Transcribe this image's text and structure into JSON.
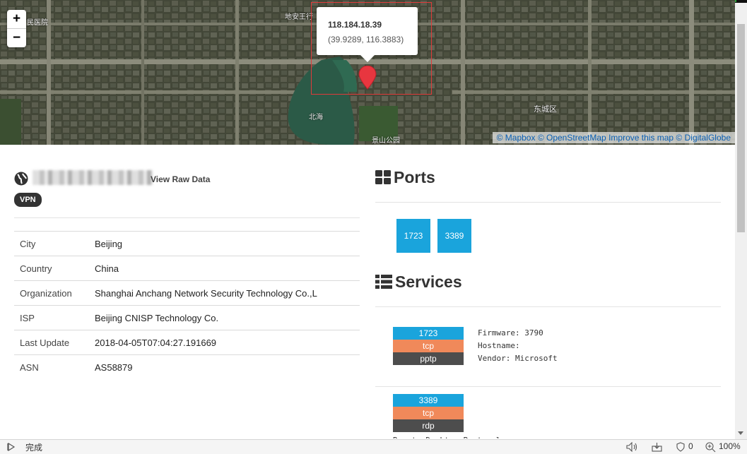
{
  "map": {
    "zoom_in_label": "+",
    "zoom_out_label": "−",
    "popup": {
      "ip": "118.184.18.39",
      "coords": "(39.9289, 116.3883)"
    },
    "labels": {
      "park_northsea": "北海",
      "park_jingshan": "景山公园",
      "district_dongcheng": "东城区",
      "top_left": "民医院",
      "top_mid": "地安王行"
    },
    "attribution": {
      "mapbox": "© Mapbox",
      "osm": "© OpenStreetMap",
      "improve": "Improve this map",
      "digitalglobe": "© DigitalGlobe"
    },
    "marker_color": "#e8363f"
  },
  "host": {
    "raw_data_link": "View Raw Data",
    "tag": "VPN"
  },
  "info": [
    {
      "key": "City",
      "value": "Beijing"
    },
    {
      "key": "Country",
      "value": "China"
    },
    {
      "key": "Organization",
      "value": "Shanghai Anchang Network Security Technology Co.,L"
    },
    {
      "key": "ISP",
      "value": "Beijing CNISP Technology Co."
    },
    {
      "key": "Last Update",
      "value": "2018-04-05T07:04:27.191669"
    },
    {
      "key": "ASN",
      "value": "AS58879"
    }
  ],
  "ports": {
    "title": "Ports",
    "list": [
      "1723",
      "3389"
    ]
  },
  "services": {
    "title": "Services",
    "list": [
      {
        "port": "1723",
        "transport": "tcp",
        "name": "pptp",
        "details": "Firmware: 3790\nHostname: \nVendor: Microsoft"
      },
      {
        "port": "3389",
        "transport": "tcp",
        "name": "rdp",
        "details": "Remote Desktop Protocol"
      }
    ]
  },
  "statusbar": {
    "status": "完成",
    "security_count": "0",
    "zoom": "100%"
  },
  "colors": {
    "port_blue": "#1aa4dc",
    "tcp_orange": "#f0895a",
    "service_dark": "#4d4d4d",
    "badge_dark": "#333333"
  }
}
